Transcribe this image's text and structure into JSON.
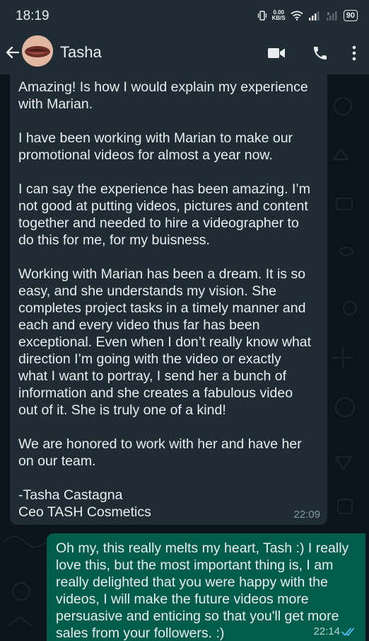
{
  "status_bar": {
    "time": "18:19",
    "net_speed_value": "0.00",
    "net_speed_unit": "KB/S",
    "battery": "90"
  },
  "chat_header": {
    "contact_name": "Tasha",
    "icons": [
      "back-arrow-icon",
      "avatar",
      "video-call-icon",
      "phone-icon",
      "more-options-icon"
    ]
  },
  "messages": [
    {
      "direction": "incoming",
      "text": "Amazing! Is how I would explain my experience\nwith Marian.\n\nI have been working with Marian to make our\npromotional videos for almost a year now.\n\nI can say the experience has been amazing. I’m\nnot good at putting videos, pictures and content\ntogether and needed to hire a videographer to\ndo this for me, for my buisness.\n\nWorking with Marian has been a dream. It is so\neasy, and she understands my vision. She\ncompletes project tasks in a timely manner and\neach and every video thus far has been\nexceptional. Even when I don’t really know what\ndirection I’m going with the video or exactly\nwhat I want to portray, I send her a bunch of\ninformation and she creates a fabulous video\nout of it. She is truly one of a kind!\n\nWe are honored to work with her and have her\non our team.\n\n-Tasha Castagna\nCeo TASH Cosmetics",
      "time": "22:09"
    },
    {
      "direction": "outgoing",
      "text": "Oh my, this really melts my heart, Tash :) I really\nlove this, but the most important thing is, I am\nreally delighted that you were happy with the\nvideos, I will make the future videos more\npersuasive and enticing so that you'll get more\nsales from your followers. :)",
      "time": "22:14",
      "status": "read"
    }
  ],
  "colors": {
    "header_bg": "#1f2c34",
    "chat_bg": "#0b141a",
    "incoming_bubble": "#1f2c34",
    "outgoing_bubble": "#005c4b",
    "read_ticks": "#53bdeb"
  }
}
